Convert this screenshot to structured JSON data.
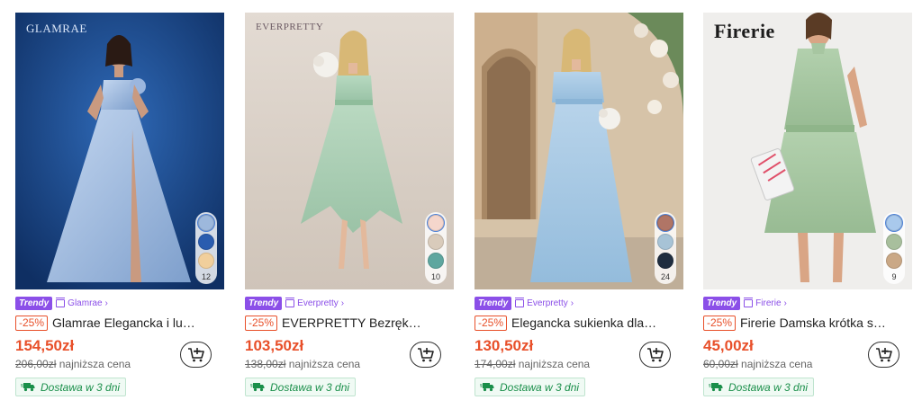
{
  "products": [
    {
      "brand_watermark": "GLAMRAE",
      "badge": "Trendy",
      "store": "Glamrae",
      "discount": "-25%",
      "title": "Glamrae Elegancka i lu…",
      "price": "154,50zł",
      "old_price": "206,00zł",
      "lowest_label": "najniższa cena",
      "shipping": "Dostawa w 3 dni",
      "swatch_colors": [
        "#9db8dc",
        "#2a5caf",
        "#f1cf9c"
      ],
      "swatch_count": "12",
      "photo_bg": "#1f4a8a",
      "dress_color": "#a9c3e6"
    },
    {
      "brand_watermark": "EVERPRETTY",
      "badge": "Trendy",
      "store": "Everpretty",
      "discount": "-25%",
      "title": "EVERPRETTY Bezręk…",
      "price": "103,50zł",
      "old_price": "138,00zł",
      "lowest_label": "najniższa cena",
      "shipping": "Dostawa w 3 dni",
      "swatch_colors": [
        "#f5d6cc",
        "#d9cbbb",
        "#5ea69f"
      ],
      "swatch_count": "10",
      "photo_bg": "#dcd3cb",
      "dress_color": "#a9cfb4"
    },
    {
      "brand_watermark": "",
      "badge": "Trendy",
      "store": "Everpretty",
      "discount": "-25%",
      "title": "Elegancka sukienka dla…",
      "price": "130,50zł",
      "old_price": "174,00zł",
      "lowest_label": "najniższa cena",
      "shipping": "Dostawa w 3 dni",
      "swatch_colors": [
        "#b07566",
        "#a7c3d6",
        "#1f2d3f"
      ],
      "swatch_count": "24",
      "photo_bg": "#c9b79f",
      "dress_color": "#a8c8e2"
    },
    {
      "brand_watermark": "Firerie",
      "badge": "Trendy",
      "store": "Firerie",
      "discount": "-25%",
      "title": "Firerie Damska krótka s…",
      "price": "45,00zł",
      "old_price": "60,00zł",
      "lowest_label": "najniższa cena",
      "shipping": "Dostawa w 3 dni",
      "swatch_colors": [
        "#a9c9ec",
        "#a8bf9d",
        "#caa886"
      ],
      "swatch_count": "9",
      "photo_bg": "#efeeec",
      "dress_color": "#a7c6a1"
    }
  ],
  "icons": {
    "cart": "add-to-cart-icon",
    "truck": "delivery-truck-icon",
    "store": "store-icon"
  },
  "colors": {
    "accent_price": "#e8502a",
    "trendy_purple": "#8b4fe8",
    "shipping_green": "#1a8f4a"
  }
}
